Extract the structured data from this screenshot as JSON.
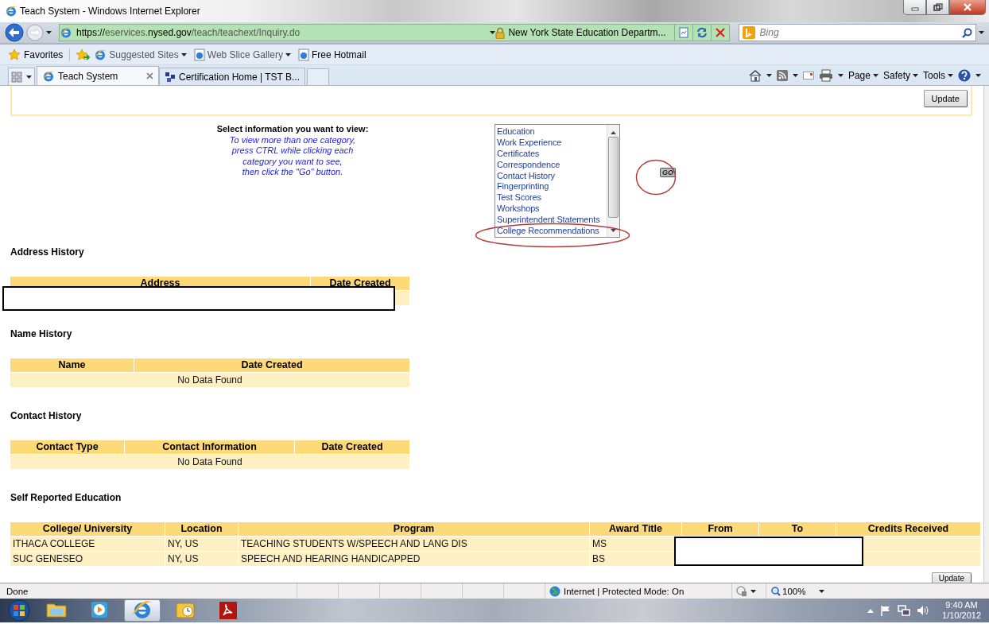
{
  "window": {
    "title": "Teach System - Windows Internet Explorer"
  },
  "address_bar": {
    "url_parts": [
      {
        "text": "https://",
        "dim": false
      },
      {
        "text": "eservices.",
        "dim": true
      },
      {
        "text": "nysed.gov",
        "dim": false
      },
      {
        "text": "/teach/teachext/Inquiry.do",
        "dim": true
      }
    ],
    "site_identity": "New York State Education Departm...",
    "search_placeholder": "Bing"
  },
  "favorites_bar": {
    "favorites": "Favorites",
    "links": [
      {
        "label": "Suggested Sites",
        "dropdown": true
      },
      {
        "label": "Web Slice Gallery",
        "dropdown": true
      },
      {
        "label": "Free Hotmail",
        "dropdown": false
      }
    ]
  },
  "tabs": [
    {
      "label": "Teach System",
      "selected": true
    },
    {
      "label": "Certification Home | TST B...",
      "selected": false
    }
  ],
  "command_bar": [
    "Page",
    "Safety",
    "Tools"
  ],
  "page": {
    "update_label": "Update",
    "instructions": {
      "title": "Select information you want to view:",
      "lines": [
        "To view more than one category,",
        "press CTRL while clicking each",
        "category you want to see,",
        "then click the \"Go\" button."
      ]
    },
    "categories": [
      {
        "label": "Education",
        "selected": false
      },
      {
        "label": "Work Experience",
        "selected": false
      },
      {
        "label": "Certificates",
        "selected": false
      },
      {
        "label": "Correspondence",
        "selected": false
      },
      {
        "label": "Contact History",
        "selected": false
      },
      {
        "label": "Fingerprinting",
        "selected": false
      },
      {
        "label": "Test Scores",
        "selected": false
      },
      {
        "label": "Workshops",
        "selected": false
      },
      {
        "label": "Superintendent Statements",
        "selected": false
      },
      {
        "label": "College Recommendations",
        "selected": false
      }
    ],
    "go_label": "GO",
    "sections": [
      {
        "title": "Address History",
        "columns": [
          "Address",
          "Date Created"
        ],
        "redacted": true,
        "rows": [
          {
            "cells": [
              "",
              ""
            ]
          }
        ]
      },
      {
        "title": "Name History",
        "columns": [
          "Name",
          "Date Created"
        ],
        "redacted": false,
        "empty_text": "No Data Found"
      },
      {
        "title": "Contact History",
        "columns": [
          "Contact Type",
          "Contact Information",
          "Date Created"
        ],
        "redacted": false,
        "empty_text": "No Data Found"
      },
      {
        "title": "Self Reported Education",
        "columns": [
          "College/ University",
          "Location",
          "Program",
          "Award Title",
          "From",
          "To",
          "Credits Received"
        ],
        "redacted": true,
        "rows": [
          {
            "cells": [
              "ITHACA COLLEGE",
              "NY, US",
              "TEACHING STUDENTS W/SPEECH AND LANG DIS",
              "MS"
            ]
          },
          {
            "cells": [
              "SUC GENESEO",
              "NY, US",
              "SPEECH AND HEARING HANDICAPPED",
              "BS"
            ]
          }
        ]
      }
    ],
    "bottom_update_label": "Update"
  },
  "status_bar": {
    "text": "Done",
    "zone": "Internet | Protected Mode: On",
    "zoom": "100%"
  },
  "taskbar": {
    "items": [
      {
        "active": false
      },
      {
        "active": false
      },
      {
        "active": true
      },
      {
        "active": false
      },
      {
        "active": false
      }
    ],
    "time": "9:40 AM",
    "date": "1/10/2012"
  }
}
